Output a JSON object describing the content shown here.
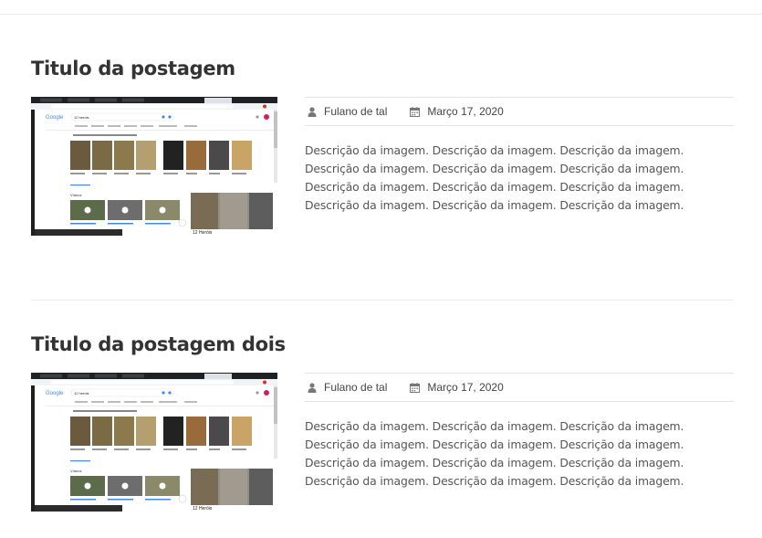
{
  "posts": [
    {
      "title": "Titulo da postagem",
      "author": "Fulano de tal",
      "date": "Março 17, 2020",
      "description": "Descrição da imagem. Descrição da imagem. Descrição da imagem. Descrição da imagem. Descrição da imagem. Descrição da imagem. Descrição da imagem. Descrição da imagem. Descrição da imagem. Descrição da imagem. Descrição da imagem. Descrição da imagem.",
      "thumbnail_caption": "12 Heróis"
    },
    {
      "title": "Titulo da postagem dois",
      "author": "Fulano de tal",
      "date": "Março 17, 2020",
      "description": "Descrição da imagem. Descrição da imagem. Descrição da imagem. Descrição da imagem. Descrição da imagem. Descrição da imagem. Descrição da imagem. Descrição da imagem. Descrição da imagem. Descrição da imagem. Descrição da imagem. Descrição da imagem.",
      "thumbnail_caption": "12 Heróis"
    }
  ],
  "thumbnail": {
    "search_logo": "Google",
    "search_query": "12 heróis",
    "videos_label": "Vídeos"
  },
  "icons": {
    "author": "user-icon",
    "date": "calendar-icon"
  },
  "colors": {
    "title": "#333333",
    "text": "#555555",
    "rule": "#e2e2e2",
    "icon": "#777777"
  }
}
